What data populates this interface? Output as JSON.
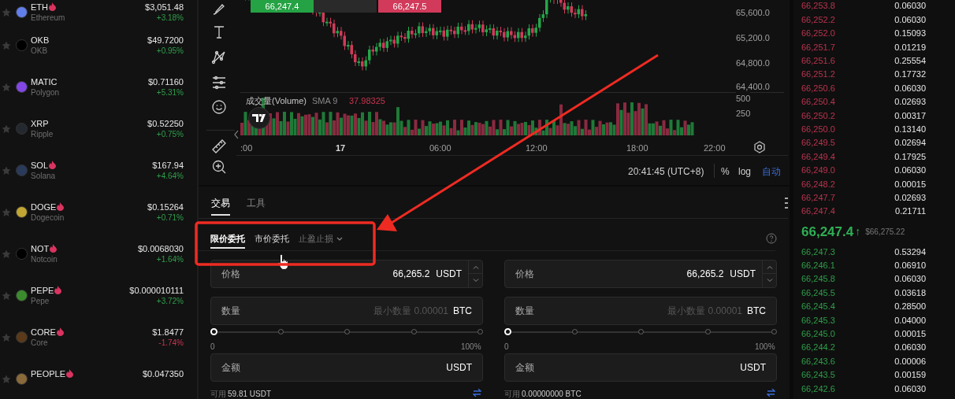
{
  "coins": [
    {
      "symbol": "ETH",
      "name": "Ethereum",
      "price": "$3,051.48",
      "change": "+3.18%",
      "up": true,
      "hot": true,
      "color": "#627eea"
    },
    {
      "symbol": "OKB",
      "name": "OKB",
      "price": "$49.7200",
      "change": "+0.95%",
      "up": true,
      "hot": false,
      "color": "#000000"
    },
    {
      "symbol": "MATIC",
      "name": "Polygon",
      "price": "$0.71160",
      "change": "+5.31%",
      "up": true,
      "hot": false,
      "color": "#8247e5"
    },
    {
      "symbol": "XRP",
      "name": "Ripple",
      "price": "$0.52250",
      "change": "+0.75%",
      "up": true,
      "hot": false,
      "color": "#23292f"
    },
    {
      "symbol": "SOL",
      "name": "Solana",
      "price": "$167.94",
      "change": "+4.64%",
      "up": true,
      "hot": true,
      "color": "#2a3a5a"
    },
    {
      "symbol": "DOGE",
      "name": "Dogecoin",
      "price": "$0.15264",
      "change": "+0.71%",
      "up": true,
      "hot": true,
      "color": "#c2a633"
    },
    {
      "symbol": "NOT",
      "name": "Notcoin",
      "price": "$0.0068030",
      "change": "+1.64%",
      "up": true,
      "hot": true,
      "color": "#000000"
    },
    {
      "symbol": "PEPE",
      "name": "Pepe",
      "price": "$0.000010111",
      "change": "+3.72%",
      "up": true,
      "hot": true,
      "color": "#3c8a2e"
    },
    {
      "symbol": "CORE",
      "name": "Core",
      "price": "$1.8477",
      "change": "-1.74%",
      "up": false,
      "hot": true,
      "color": "#5a3a1a"
    },
    {
      "symbol": "PEOPLE",
      "price": "$0.047350",
      "hot": true,
      "color": "#8a6a3a"
    }
  ],
  "chart": {
    "order_buttons": [
      {
        "label": "66,247.4",
        "color": "#25a244"
      },
      {
        "label": "66,247.5",
        "color": "#d13a5a"
      }
    ],
    "price_axis": [
      "65,600.0",
      "65,200.0",
      "64,800.0",
      "64,400.0"
    ],
    "volume_axis": [
      "500",
      "250"
    ],
    "volume_label": "成交量(Volume)",
    "volume_sma": "SMA 9",
    "volume_value": "37.98325",
    "time_axis": [
      ":00",
      "17",
      "06:00",
      "12:00",
      "18:00",
      "22:00"
    ],
    "time": "20:41:45 (UTC+8)",
    "percent": "%",
    "log": "log",
    "auto": "自动"
  },
  "trade": {
    "tabs": [
      {
        "label": "交易",
        "selected": true
      },
      {
        "label": "工具",
        "selected": false
      }
    ],
    "order_types": [
      {
        "label": "限价委托",
        "selected": true,
        "dropdown": false
      },
      {
        "label": "市价委托",
        "selected": false,
        "dropdown": false
      },
      {
        "label": "止盈止损",
        "selected": false,
        "dropdown": true
      }
    ],
    "forms": [
      {
        "price_label": "价格",
        "price": "66,265.2",
        "price_unit": "USDT",
        "qty_label": "数量",
        "qty_placeholder": "最小数量 0.00001",
        "qty_unit": "BTC",
        "level": 0,
        "min": "0",
        "max": "100%",
        "amount_label": "金额",
        "amount_unit": "USDT",
        "avail_label": "可用",
        "avail": "59.81 USDT"
      },
      {
        "price_label": "价格",
        "price": "66,265.2",
        "price_unit": "USDT",
        "qty_label": "数量",
        "qty_placeholder": "最小数量 0.00001",
        "qty_unit": "BTC",
        "level": 0,
        "min": "0",
        "max": "100%",
        "amount_label": "金额",
        "amount_unit": "USDT",
        "avail_label": "可用",
        "avail": "0.00000000 BTC"
      }
    ]
  },
  "order_book": {
    "asks": [
      {
        "price": "66,253.8",
        "qty": "0.06030"
      },
      {
        "price": "66,252.2",
        "qty": "0.06030"
      },
      {
        "price": "66,252.0",
        "qty": "0.15093"
      },
      {
        "price": "66,251.7",
        "qty": "0.01219"
      },
      {
        "price": "66,251.6",
        "qty": "0.25554"
      },
      {
        "price": "66,251.2",
        "qty": "0.17732"
      },
      {
        "price": "66,250.6",
        "qty": "0.06030"
      },
      {
        "price": "66,250.4",
        "qty": "0.02693"
      },
      {
        "price": "66,250.2",
        "qty": "0.00317"
      },
      {
        "price": "66,250.0",
        "qty": "0.13140"
      },
      {
        "price": "66,249.5",
        "qty": "0.02694"
      },
      {
        "price": "66,249.4",
        "qty": "0.17925"
      },
      {
        "price": "66,249.0",
        "qty": "0.06030"
      },
      {
        "price": "66,248.2",
        "qty": "0.00015"
      },
      {
        "price": "66,247.7",
        "qty": "0.02693"
      },
      {
        "price": "66,247.4",
        "qty": "0.21711"
      }
    ],
    "last_price": "66,247.4",
    "last_arrow": "↑",
    "last_usd": "$66,275.22",
    "bids": [
      {
        "price": "66,247.3",
        "qty": "0.53294"
      },
      {
        "price": "66,246.1",
        "qty": "0.06910"
      },
      {
        "price": "66,245.8",
        "qty": "0.06030"
      },
      {
        "price": "66,245.5",
        "qty": "0.03618"
      },
      {
        "price": "66,245.4",
        "qty": "0.28500"
      },
      {
        "price": "66,245.3",
        "qty": "0.04000"
      },
      {
        "price": "66,245.0",
        "qty": "0.00015"
      },
      {
        "price": "66,244.2",
        "qty": "0.06030"
      },
      {
        "price": "66,243.6",
        "qty": "0.00006"
      },
      {
        "price": "66,243.5",
        "qty": "0.00159"
      },
      {
        "price": "66,242.6",
        "qty": "0.06030"
      }
    ]
  },
  "annotations": {
    "highlight_frame": true,
    "arrow": true
  }
}
